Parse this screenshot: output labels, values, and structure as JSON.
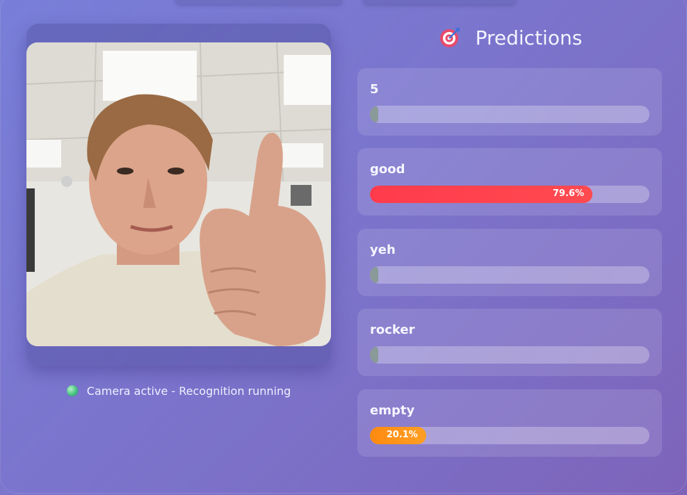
{
  "camera": {
    "status_text": "Camera active - Recognition running",
    "status_color": "#3fbf7a"
  },
  "predictions": {
    "title": "Predictions",
    "title_icon": "target-icon",
    "items": [
      {
        "label": "5",
        "percent": 0,
        "value_text": "",
        "color": "#8a9a98"
      },
      {
        "label": "good",
        "percent": 79.6,
        "value_text": "79.6%",
        "color": "#ff4050"
      },
      {
        "label": "yeh",
        "percent": 0,
        "value_text": "",
        "color": "#8a9a98"
      },
      {
        "label": "rocker",
        "percent": 0,
        "value_text": "",
        "color": "#8a9a98"
      },
      {
        "label": "empty",
        "percent": 20.1,
        "value_text": "20.1%",
        "color": "#ff9415"
      }
    ]
  }
}
